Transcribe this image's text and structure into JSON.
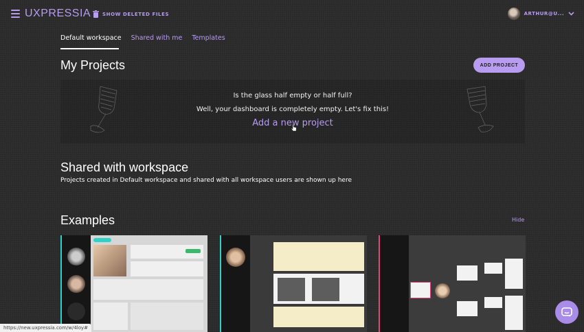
{
  "header": {
    "logo": "UXPRESSIA",
    "show_deleted": "SHOW DELETED FILES",
    "user_name": "ARTHUR@U...",
    "accent": "#b79cf0"
  },
  "tabs": [
    {
      "label": "Default workspace",
      "active": true
    },
    {
      "label": "Shared with me",
      "active": false
    },
    {
      "label": "Templates",
      "active": false
    }
  ],
  "projects": {
    "title": "My Projects",
    "add_button": "ADD PROJECT",
    "empty_line1": "Is the glass half empty or half full?",
    "empty_line2": "Well, your dashboard is completely empty. Let's fix this!",
    "add_link": "Add a new project"
  },
  "shared": {
    "title": "Shared with workspace",
    "subtitle": "Projects created in Default workspace and shared with all workspace users are shown up here"
  },
  "examples": {
    "title": "Examples",
    "hide": "Hide",
    "cards": [
      {
        "accent": "#2ed3c8"
      },
      {
        "accent": "#2ed3c8"
      },
      {
        "accent": "#e0447a"
      }
    ]
  },
  "status_url": "https://new.uxpressia.com/w/4loy#",
  "icons": [
    "menu-icon",
    "trash-icon",
    "chevron-down-icon",
    "chat-icon",
    "glass-icon",
    "cursor-icon"
  ]
}
